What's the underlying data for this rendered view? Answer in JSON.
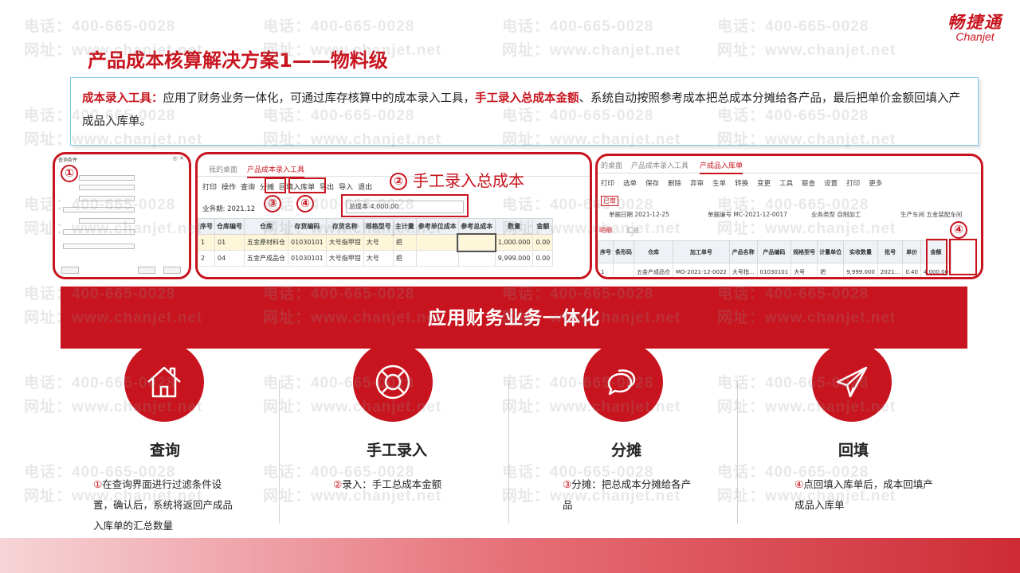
{
  "header": {
    "title": "产品成本核算解决方案1——物料级",
    "logo_cn": "畅捷通",
    "logo_en": "Chanjet"
  },
  "description": {
    "label": "成本录入工具：",
    "text1": "应用了财务业务一体化，可通过库存核算中的成本录入工具，",
    "highlight": "手工录入总成本金额",
    "text2": "、系统自动按照参考成本把总成本分摊给各产品，最后把单价金额回填入产成品入库单。"
  },
  "markers": {
    "m1": "①",
    "m2": "②",
    "m3": "③",
    "m4": "④"
  },
  "panel2": {
    "tabs": [
      "我的桌面",
      "产品成本录入工具"
    ],
    "toolbar": [
      "打印",
      "操作",
      "查询",
      "分摊",
      "回填入库单",
      "导出",
      "导入",
      "退出"
    ],
    "period_label": "业务期: 2021.12",
    "total_label": "总成本 4,000.00",
    "hand_label": "手工录入总成本",
    "columns": [
      "序号",
      "仓库编号",
      "仓库",
      "存货编码",
      "存货名称",
      "规格型号",
      "主计量",
      "参考单位成本",
      "参考总成本",
      "数量",
      "金额"
    ],
    "rows": [
      [
        "1",
        "01",
        "五金原材料仓",
        "01030101",
        "大号指甲钳",
        "大号",
        "把",
        "",
        "",
        "1,000.000",
        "0.00"
      ],
      [
        "2",
        "04",
        "五金产成品仓",
        "01030101",
        "大号指甲钳",
        "大号",
        "把",
        "",
        "",
        "9,999.000",
        "0.00"
      ]
    ]
  },
  "panel3": {
    "tabs": [
      "的桌面",
      "产品成本录入工具",
      "产成品入库单"
    ],
    "toolbar": [
      "打印",
      "选单",
      "保存",
      "删除",
      "弃审",
      "生单",
      "转换",
      "变更",
      "工具",
      "联查",
      "设置",
      "打印",
      "更多"
    ],
    "stamp": "已审",
    "meta": [
      "单据日期 2021-12-25",
      "单据编号 MC-2021-12-0017",
      "业务类型 自制加工",
      "生产车间 五金装配车间"
    ],
    "subtabs": [
      "明细",
      "汇总"
    ],
    "columns": [
      "序号",
      "条形码",
      "仓库",
      "加工单号",
      "产品名称",
      "产品编码",
      "规格型号",
      "计量单位",
      "实收数量",
      "批号",
      "单价",
      "金额"
    ],
    "rows": [
      [
        "1",
        "",
        "五金产成品仓",
        "MO-2021-12-0022",
        "大号指...",
        "01030101",
        "大号",
        "把",
        "9,999.000",
        "2021...",
        "0.40",
        "4,000.00"
      ]
    ]
  },
  "banner": "应用财务业务一体化",
  "steps": [
    {
      "title": "查询",
      "num": "①",
      "desc": "在查询界面进行过滤条件设置，确认后，系统将返回产成品入库单的汇总数量",
      "icon": "house-icon"
    },
    {
      "title": "手工录入",
      "num": "②",
      "desc": "录入：手工总成本金额",
      "icon": "lifebuoy-icon"
    },
    {
      "title": "分摊",
      "num": "③",
      "desc": "分摊：把总成本分摊给各产品",
      "icon": "chat-icon"
    },
    {
      "title": "回填",
      "num": "④",
      "desc": "点回填入库单后，成本回填产成品入库单",
      "icon": "paper-plane-icon"
    }
  ],
  "watermark": {
    "phone": "电话：400-665-0028",
    "site": "网址：www.chanjet.net"
  },
  "colors": {
    "brand_red": "#c8141e",
    "desc_border": "#7cc7e0",
    "highlight_row": "#fdf6d8"
  }
}
